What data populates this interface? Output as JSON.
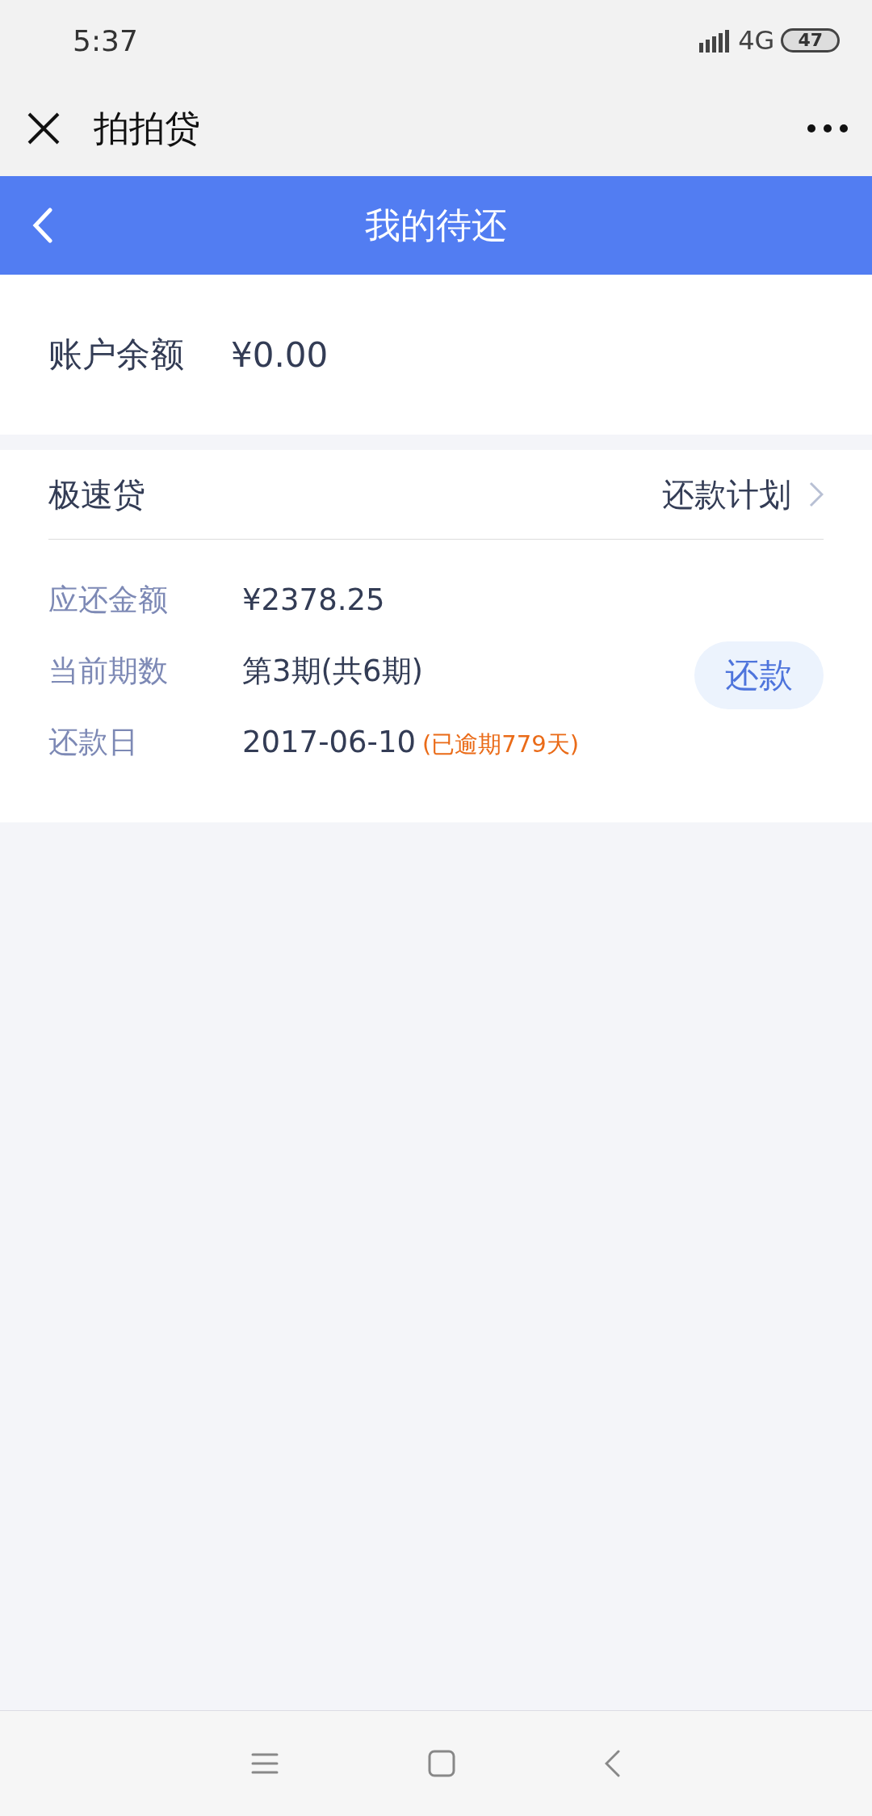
{
  "status_bar": {
    "time": "5:37",
    "network": "4G",
    "battery": "47"
  },
  "app_bar": {
    "title": "拍拍贷"
  },
  "header": {
    "title": "我的待还"
  },
  "balance": {
    "label": "账户余额",
    "value": "¥0.00"
  },
  "loan": {
    "name": "极速贷",
    "plan_link": "还款计划",
    "details": [
      {
        "label": "应还金额",
        "value": "¥2378.25"
      },
      {
        "label": "当前期数",
        "value": "第3期(共6期)"
      },
      {
        "label": "还款日",
        "value": "2017-06-10",
        "note": "(已逾期779天)"
      }
    ],
    "pay_button": "还款"
  }
}
